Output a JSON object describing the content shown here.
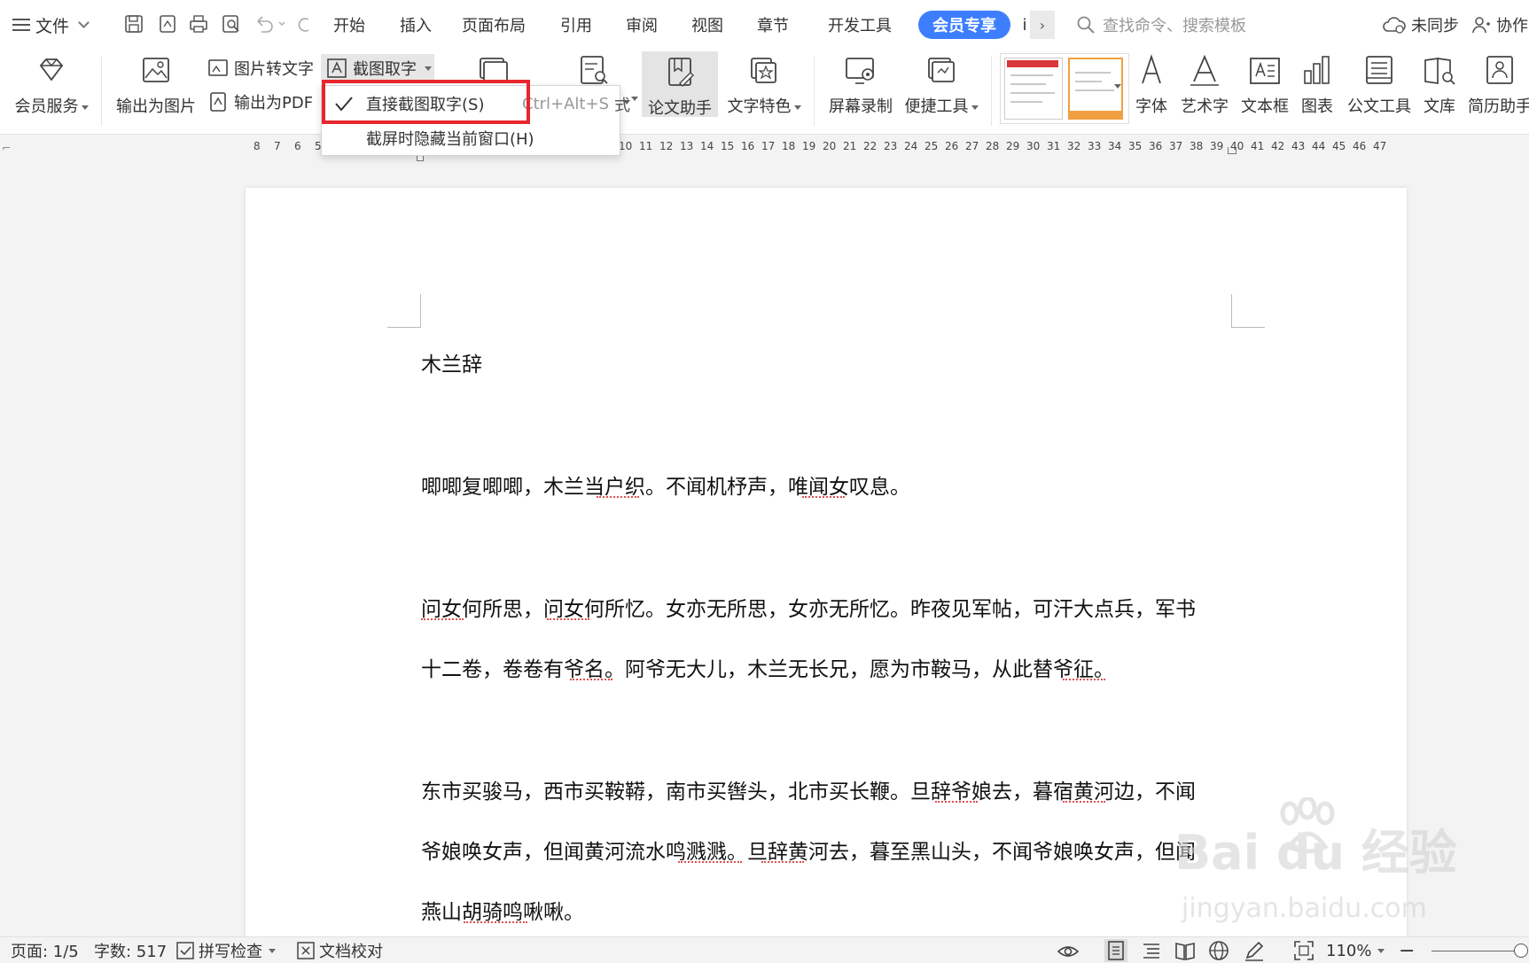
{
  "topbar": {
    "file_label": "文件",
    "tabs": [
      "开始",
      "插入",
      "页面布局",
      "引用",
      "审阅",
      "视图",
      "章节",
      "开发工具"
    ],
    "vip_tab": "会员专享",
    "more_tab_partial": "i",
    "search_placeholder": "查找命令、搜索模板",
    "sync_label": "未同步",
    "collab_label": "协作"
  },
  "ribbon": {
    "member_services": "会员服务",
    "export_image": "输出为图片",
    "image_to_text": "图片转文字",
    "export_pdf": "输出为PDF",
    "screenshot_ocr": "截图取字",
    "paper_assistant": "论文助手",
    "text_features": "文字特色",
    "screen_record": "屏幕录制",
    "quick_tools": "便捷工具",
    "font": "字体",
    "wordart": "艺术字",
    "textbox": "文本框",
    "chart": "图表",
    "official_tools": "公文工具",
    "library": "文库",
    "resume_helper": "简历助手"
  },
  "dropdown": {
    "item1": "直接截图取字(S)",
    "item1_shortcut": "Ctrl+Alt+S",
    "item2": "截屏时隐藏当前窗口(H)",
    "peek_text": "式"
  },
  "ruler": [
    "8",
    "7",
    "6",
    "5",
    "10",
    "11",
    "12",
    "13",
    "14",
    "15",
    "16",
    "17",
    "18",
    "19",
    "20",
    "21",
    "22",
    "23",
    "24",
    "25",
    "26",
    "27",
    "28",
    "29",
    "30",
    "31",
    "32",
    "33",
    "34",
    "35",
    "36",
    "37",
    "38",
    "39",
    "40",
    "41",
    "42",
    "43",
    "44",
    "45",
    "46",
    "47"
  ],
  "document": {
    "title": "木兰辞",
    "lines": [
      "唧唧复唧唧，木兰当户织。不闻机杼声，唯闻女叹息。",
      "问女何所思，问女何所忆。女亦无所思，女亦无所忆。昨夜见军帖，可汗大点兵，军书",
      "十二卷，卷卷有爷名。阿爷无大儿，木兰无长兄，愿为市鞍马，从此替爷征。",
      "东市买骏马，西市买鞍鞯，南市买辔头，北市买长鞭。旦辞爷娘去，暮宿黄河边，不闻",
      "爷娘唤女声，但闻黄河流水鸣溅溅。旦辞黄河去，暮至黑山头，不闻爷娘唤女声，但闻",
      "燕山胡骑鸣啾啾。"
    ]
  },
  "watermark": {
    "brand": "Bai du 经验",
    "url": "jingyan.baidu.com"
  },
  "statusbar": {
    "page": "页面: 1/5",
    "word_count": "字数: 517",
    "spell_check": "拼写检查",
    "doc_proof": "文档校对",
    "zoom": "110%"
  },
  "colors": {
    "vip_tab": "#3d7eff",
    "highlight_box": "#e8262d",
    "spell_underline": "#e05050"
  }
}
